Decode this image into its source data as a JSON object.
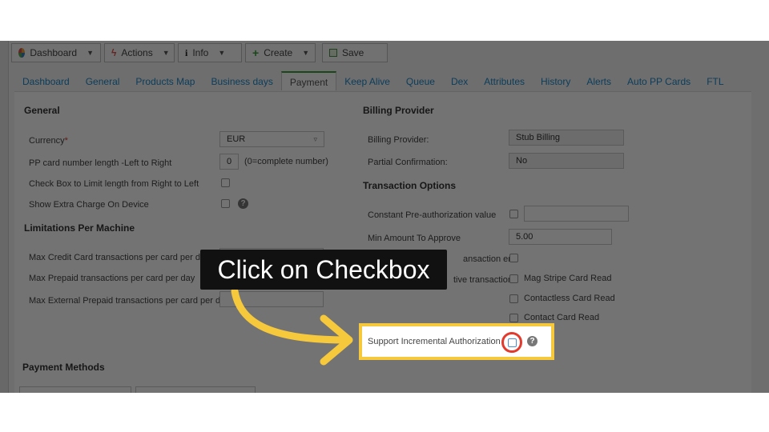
{
  "toolbar": {
    "dashboard": "Dashboard",
    "actions": "Actions",
    "info": "Info",
    "create": "Create",
    "save": "Save"
  },
  "tabs": [
    "Dashboard",
    "General",
    "Products Map",
    "Business days",
    "Payment",
    "Keep Alive",
    "Queue",
    "Dex",
    "Attributes",
    "History",
    "Alerts",
    "Auto PP Cards",
    "FTL"
  ],
  "active_tab": "Payment",
  "general": {
    "heading": "General",
    "currency_label": "Currency",
    "currency_value": "EUR",
    "pp_length_label": "PP card number length -Left to Right",
    "pp_length_value": "0",
    "pp_length_hint": "(0=complete number)",
    "limit_label": "Check Box to Limit length from Right to Left",
    "extra_charge_label": "Show Extra Charge On Device"
  },
  "limitations": {
    "heading": "Limitations Per Machine",
    "credit_label": "Max Credit Card transactions per card per day",
    "prepaid_label": "Max Prepaid transactions per card per day",
    "external_label": "Max External Prepaid transactions per card per day"
  },
  "payment_methods": {
    "heading": "Payment Methods"
  },
  "billing": {
    "heading": "Billing Provider",
    "provider_label": "Billing Provider:",
    "provider_value": "Stub Billing",
    "partial_label": "Partial Confirmation:",
    "partial_value": "No"
  },
  "transaction": {
    "heading": "Transaction Options",
    "preauth_label": "Constant Pre-authorization value",
    "min_amount_label": "Min Amount To Approve",
    "min_amount_value": "5.00",
    "end_label_partial": "ansaction end",
    "negative_label_partial": "tive transaction",
    "mag_stripe": "Mag Stripe Card Read",
    "contactless": "Contactless Card Read",
    "contact": "Contact Card Read",
    "incremental_label": "Support Incremental Authorization"
  },
  "callout": {
    "text": "Click on Checkbox"
  },
  "colors": {
    "highlight": "#f6c83c",
    "ring": "#e23b2e",
    "link": "#1e88c8",
    "active_tab_accent": "#3a9b3a"
  }
}
